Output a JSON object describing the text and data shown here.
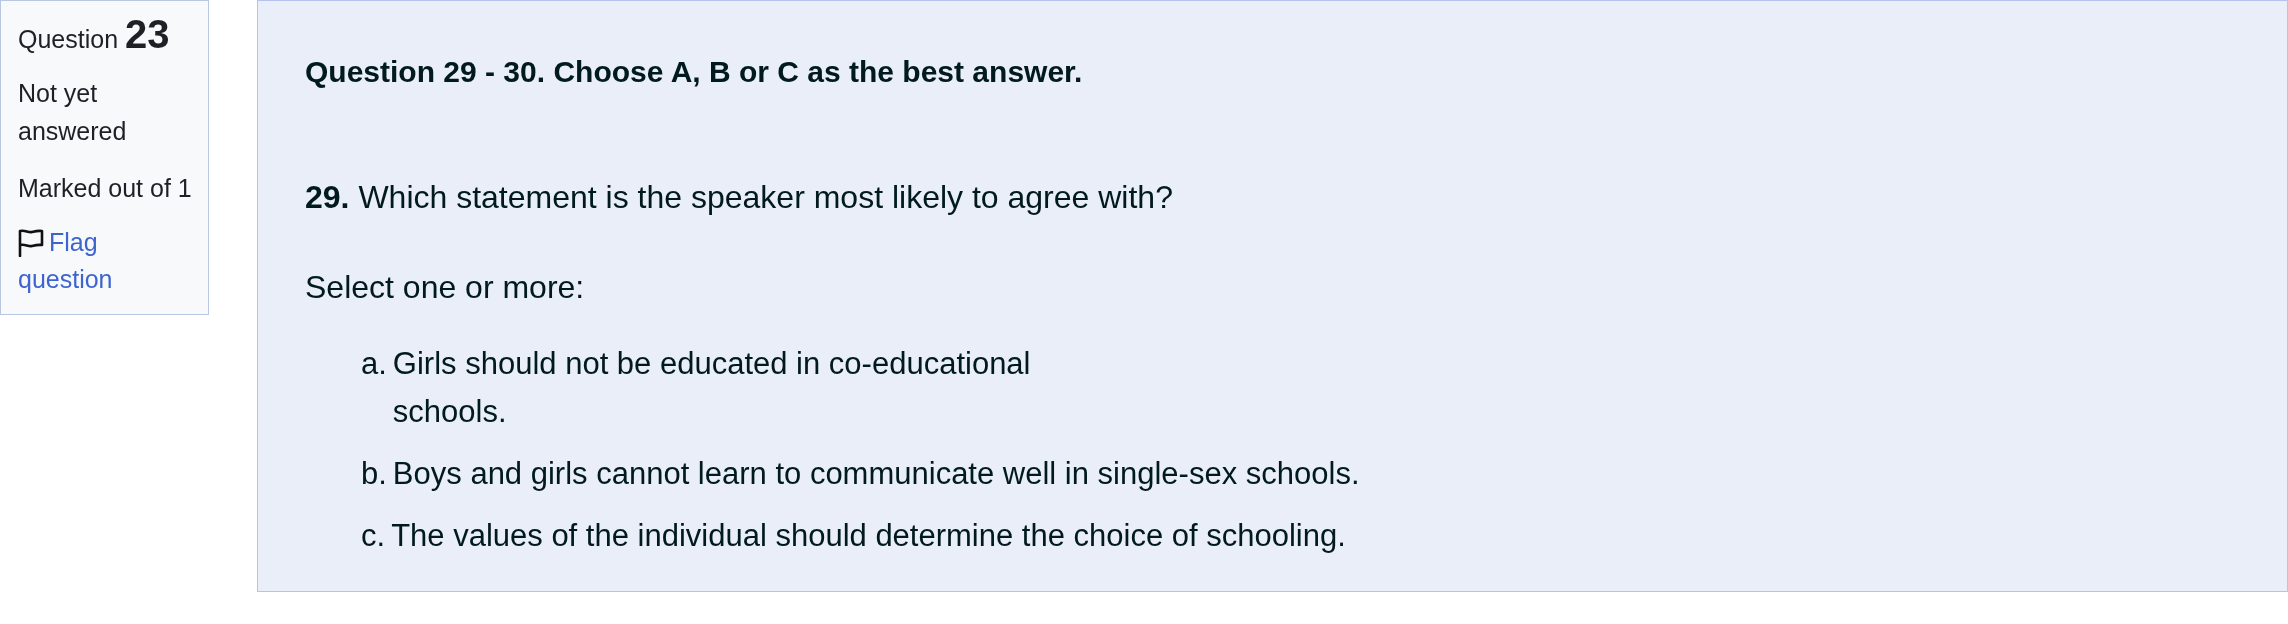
{
  "sidebar": {
    "title": "Question **23**",
    "status": "Not yet answered",
    "marks": "Marked out of 1",
    "flag_link": {
      "label": "Flag question",
      "flagged": false
    }
  },
  "question": {
    "instruction": "Question 29 - 30. Choose A, B or C as the best answer.",
    "prompt": "**29.** Which statement is the speaker most likely to agree with?",
    "select_hint": "Select one or more:",
    "options": [
      {
        "letter": "a.",
        "text": "Girls should not be educated in co-educational schools."
      },
      {
        "letter": "b.",
        "text": "Boys and girls cannot learn to communicate well in single-sex schools."
      },
      {
        "letter": "c.",
        "text": "The values of the individual should determine the choice of schooling."
      }
    ]
  }
}
